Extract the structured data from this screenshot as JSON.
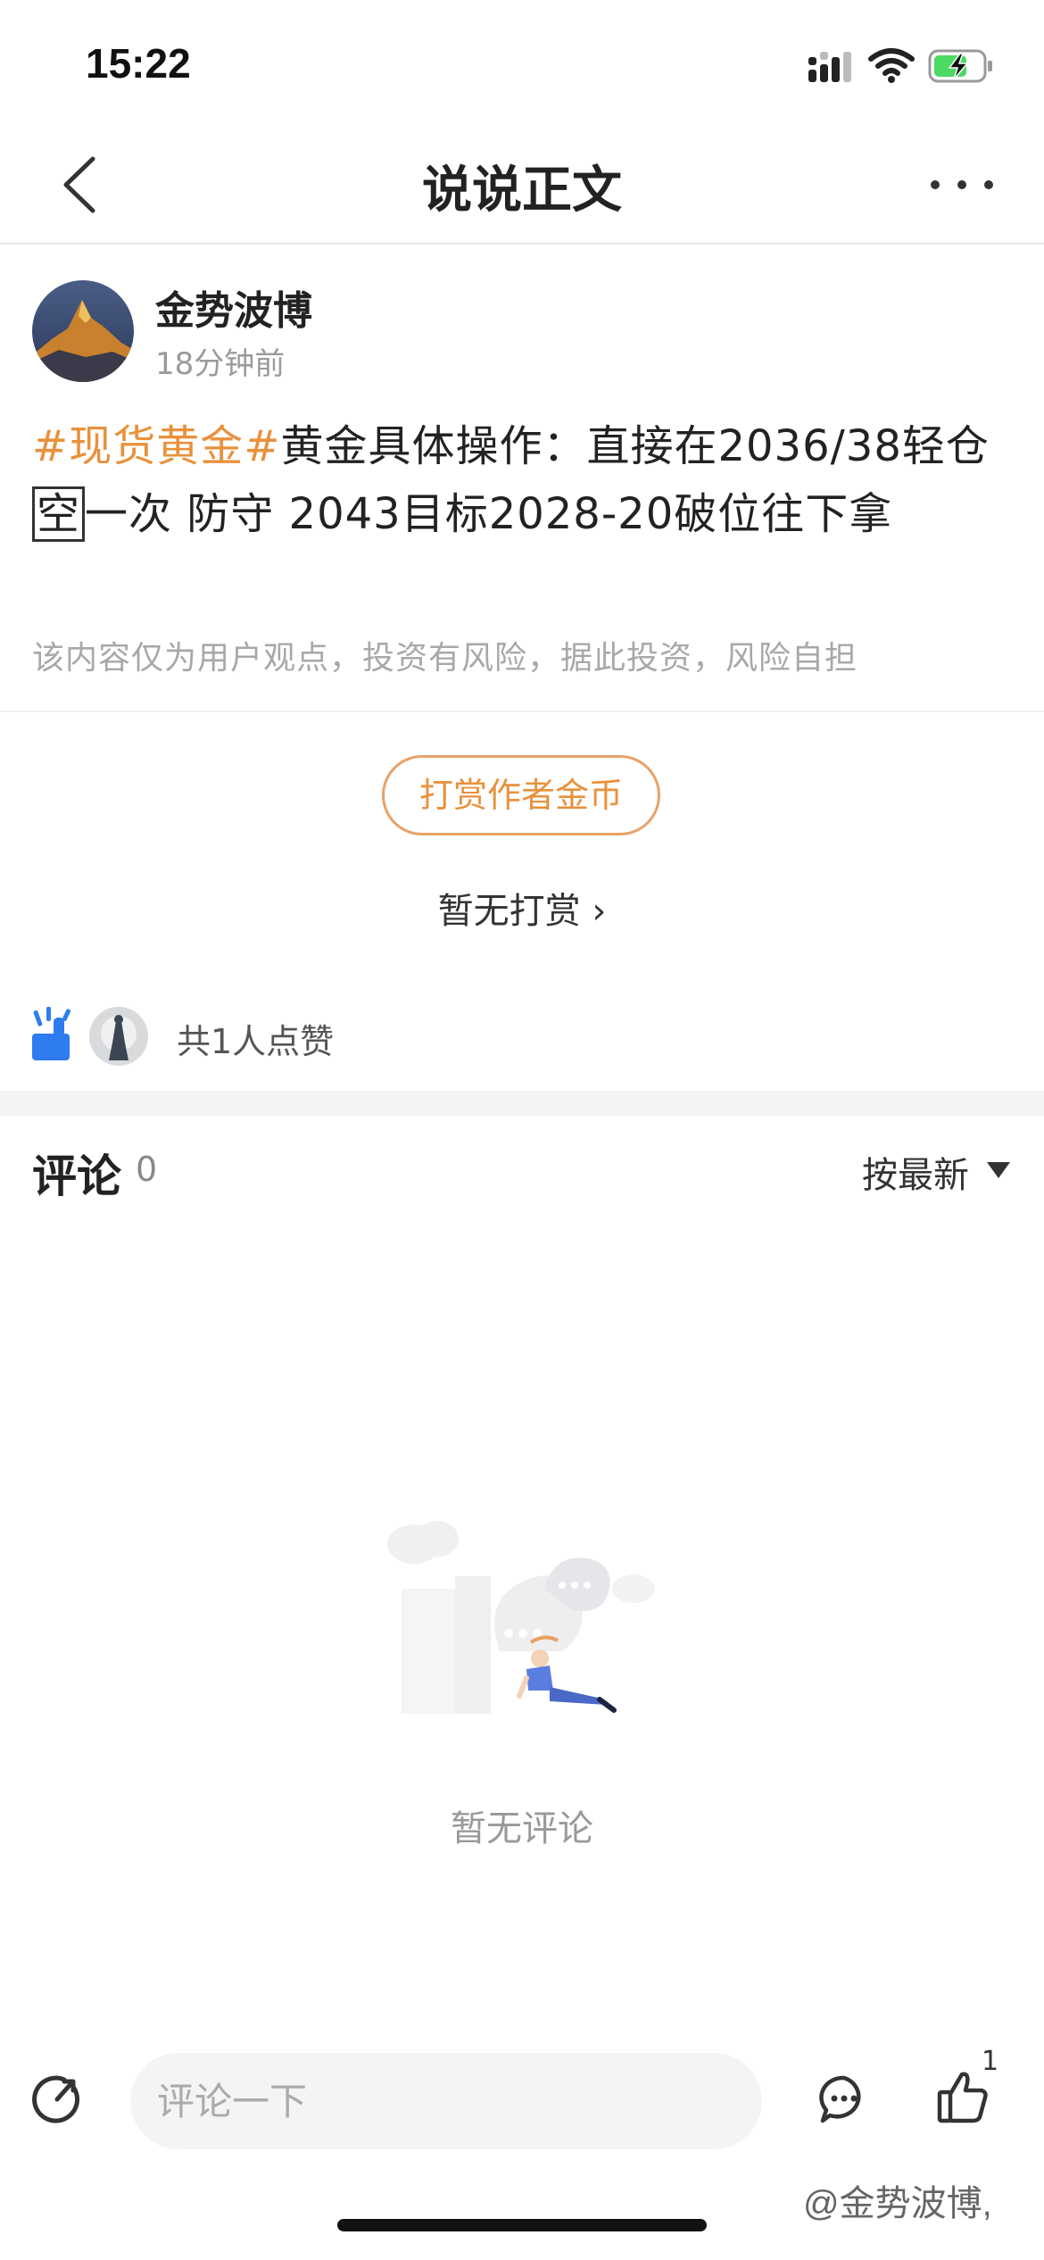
{
  "status_bar": {
    "time": "15:22"
  },
  "nav": {
    "title": "说说正文"
  },
  "post": {
    "author": "金势波博",
    "time_ago": "18分钟前",
    "topic": "#现货黄金#",
    "text_part1": "黄金具体操作：直接在2036/38轻仓",
    "boxed_char": "空",
    "text_part2": "一次 防守 2043目标2028-20破位往下拿",
    "disclaimer": "该内容仅为用户观点，投资有风险，据此投资，风险自担"
  },
  "reward": {
    "button_label": "打赏作者金币",
    "status": "暂无打赏 ›"
  },
  "likes": {
    "summary": "共1人点赞"
  },
  "comments": {
    "title": "评论",
    "count": "0",
    "sort_label": "按最新",
    "empty_text": "暂无评论"
  },
  "bottom_bar": {
    "input_placeholder": "评论一下",
    "like_count": "1"
  },
  "watermark": "@金势波博,",
  "colors": {
    "accent_orange": "#e8913c",
    "like_blue": "#2f7bf0"
  }
}
